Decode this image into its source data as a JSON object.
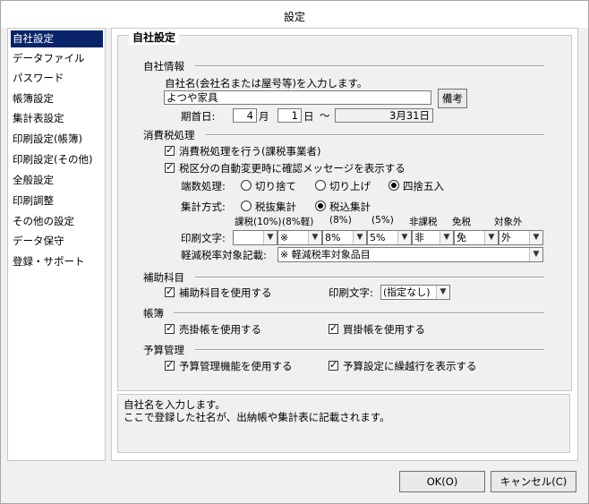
{
  "window": {
    "title": "設定"
  },
  "sidebar": {
    "items": [
      {
        "label": "自社設定"
      },
      {
        "label": "データファイル"
      },
      {
        "label": "パスワード"
      },
      {
        "label": "帳簿設定"
      },
      {
        "label": "集計表設定"
      },
      {
        "label": "印刷設定(帳簿)"
      },
      {
        "label": "印刷設定(その他)"
      },
      {
        "label": "全般設定"
      },
      {
        "label": "印刷調整"
      },
      {
        "label": "その他の設定"
      },
      {
        "label": "データ保守"
      },
      {
        "label": "登録・サポート"
      }
    ]
  },
  "panel": {
    "title": "自社設定"
  },
  "company": {
    "section": "自社情報",
    "name_label": "自社名(会社名または屋号等)を入力します。",
    "name_value": "よつや家具",
    "notes_button": "備考",
    "period_label": "期首日:",
    "start_month": "4",
    "month_unit": "月",
    "start_day": "1",
    "day_unit": "日",
    "tilde": "～",
    "end_date": "3月31日"
  },
  "tax": {
    "section": "消費税処理",
    "check1": "消費税処理を行う(課税事業者)",
    "check2": "税区分の自動変更時に確認メッセージを表示する",
    "rounding_label": "端数処理:",
    "rounding_options": [
      "切り捨て",
      "切り上げ",
      "四捨五入"
    ],
    "method_label": "集計方式:",
    "method_options": [
      "税抜集計",
      "税込集計"
    ],
    "col_headers": [
      "課税(10%)",
      "(8%軽)",
      "(8%)",
      "(5%)",
      "非課税",
      "免税",
      "対象外"
    ],
    "print_label": "印刷文字:",
    "print_values": [
      "",
      "※",
      "8%",
      "5%",
      "非",
      "免",
      "外"
    ],
    "reduced_label": "軽減税率対象記載:",
    "reduced_value": "※ 軽減税率対象品目"
  },
  "aux": {
    "section": "補助科目",
    "check": "補助科目を使用する",
    "print_label": "印刷文字:",
    "print_value": "(指定なし)"
  },
  "ledger": {
    "section": "帳簿",
    "check1": "売掛帳を使用する",
    "check2": "買掛帳を使用する"
  },
  "budget": {
    "section": "予算管理",
    "check1": "予算管理機能を使用する",
    "check2": "予算設定に繰越行を表示する"
  },
  "help": {
    "line1": "自社名を入力します。",
    "line2": "ここで登録した社名が、出納帳や集計表に記載されます。"
  },
  "footer": {
    "ok": "OK(O)",
    "cancel": "キャンセル(C)"
  }
}
